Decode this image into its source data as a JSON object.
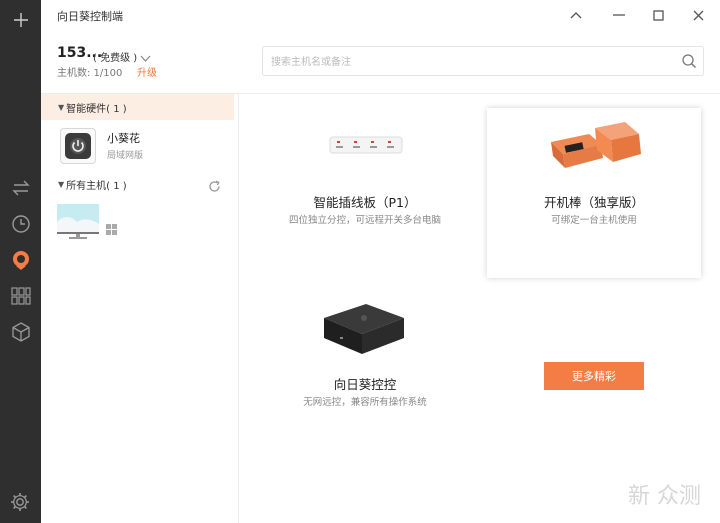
{
  "app": {
    "title": "向日葵控制端"
  },
  "account": {
    "id": "153...",
    "tier": "( 免费级 )",
    "host_count_label": "主机数: 1/100",
    "upgrade_label": "升级"
  },
  "search": {
    "placeholder": "搜索主机名或备注"
  },
  "sidebar": {
    "hardware_group": "智能硬件( 1 )",
    "hosts_group": "所有主机( 1 )",
    "device": {
      "name": "小葵花",
      "network": "局域网版"
    }
  },
  "products": [
    {
      "title": "智能插线板（P1）",
      "desc": "四位独立分控，可远程开关多台电脑"
    },
    {
      "title": "开机棒（独享版）",
      "desc": "可绑定一台主机使用"
    },
    {
      "title": "向日葵控控",
      "desc": "无网远控，兼容所有操作系统"
    }
  ],
  "more_button": "更多精彩",
  "watermark": "新 众测",
  "colors": {
    "accent": "#f47d46",
    "rail": "#2f2f2f",
    "active_bg": "#fdeee4"
  },
  "icons": [
    "plus-icon",
    "swap-icon",
    "clock-icon",
    "sunflower-icon",
    "apps-icon",
    "cube-icon",
    "gear-icon",
    "search-icon",
    "refresh-icon",
    "windows-icon",
    "power-icon"
  ]
}
